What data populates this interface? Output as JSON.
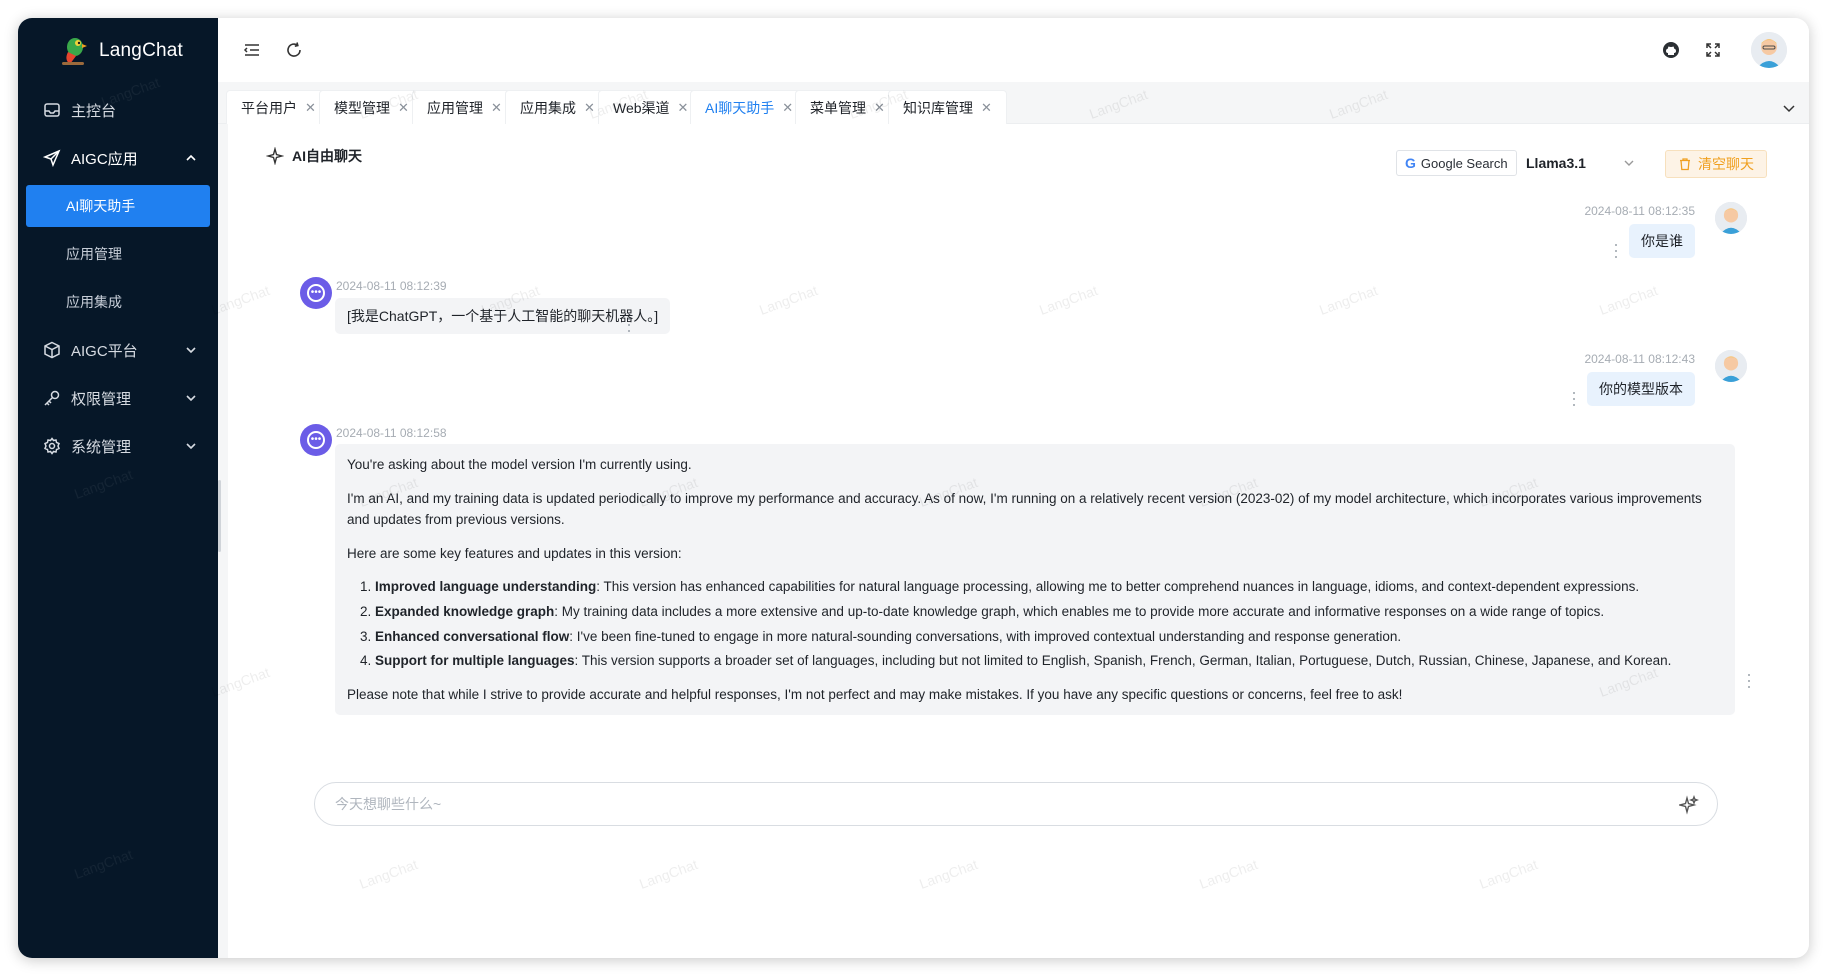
{
  "app": {
    "name": "LangChat"
  },
  "watermark": "LangChat",
  "sidebar": {
    "items": [
      {
        "label": "主控台",
        "icon": "dashboard-icon"
      },
      {
        "label": "AIGC应用",
        "icon": "send-plane-icon",
        "expanded": true,
        "children": [
          {
            "label": "AI聊天助手",
            "active": true
          },
          {
            "label": "应用管理"
          },
          {
            "label": "应用集成"
          }
        ]
      },
      {
        "label": "AIGC平台",
        "icon": "cube-icon",
        "expanded": false
      },
      {
        "label": "权限管理",
        "icon": "key-icon",
        "expanded": false
      },
      {
        "label": "系统管理",
        "icon": "gear-icon",
        "expanded": false
      }
    ]
  },
  "tabs": [
    {
      "label": "平台用户"
    },
    {
      "label": "模型管理"
    },
    {
      "label": "应用管理"
    },
    {
      "label": "应用集成"
    },
    {
      "label": "Web渠道"
    },
    {
      "label": "AI聊天助手",
      "active": true
    },
    {
      "label": "菜单管理"
    },
    {
      "label": "知识库管理"
    }
  ],
  "chat": {
    "title": "AI自由聊天",
    "search_tool": "Google Search",
    "model": "Llama3.1",
    "clear_label": "清空聊天",
    "input_placeholder": "今天想聊些什么~",
    "messages": [
      {
        "role": "user",
        "time": "2024-08-11 08:12:35",
        "text": "你是谁"
      },
      {
        "role": "bot",
        "time": "2024-08-11 08:12:39",
        "text": "[我是ChatGPT，一个基于人工智能的聊天机器人。]"
      },
      {
        "role": "user",
        "time": "2024-08-11 08:12:43",
        "text": "你的模型版本"
      },
      {
        "role": "bot",
        "time": "2024-08-11 08:12:58",
        "intro": "You're asking about the model version I'm currently using.",
        "para1": "I'm an AI, and my training data is updated periodically to improve my performance and accuracy. As of now, I'm running on a relatively recent version (2023-02) of my model architecture, which incorporates various improvements and updates from previous versions.",
        "para2": "Here are some key features and updates in this version:",
        "features": [
          {
            "title": "Improved language understanding",
            "text": ": This version has enhanced capabilities for natural language processing, allowing me to better comprehend nuances in language, idioms, and context-dependent expressions."
          },
          {
            "title": "Expanded knowledge graph",
            "text": ": My training data includes a more extensive and up-to-date knowledge graph, which enables me to provide more accurate and informative responses on a wide range of topics."
          },
          {
            "title": "Enhanced conversational flow",
            "text": ": I've been fine-tuned to engage in more natural-sounding conversations, with improved contextual understanding and response generation."
          },
          {
            "title": "Support for multiple languages",
            "text": ": This version supports a broader set of languages, including but not limited to English, Spanish, French, German, Italian, Portuguese, Dutch, Russian, Chinese, Japanese, and Korean."
          }
        ],
        "closing": "Please note that while I strive to provide accurate and helpful responses, I'm not perfect and may make mistakes. If you have any specific questions or concerns, feel free to ask!"
      }
    ]
  },
  "colors": {
    "accent": "#2080f0",
    "sidebar_bg": "#061728",
    "warning": "#f0a020",
    "bot_avatar": "#6b5ce7"
  }
}
